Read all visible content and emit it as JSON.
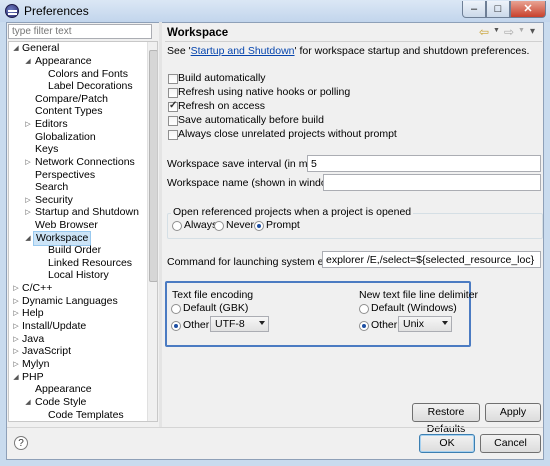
{
  "window": {
    "title": "Preferences"
  },
  "filter": {
    "placeholder": "type filter text"
  },
  "tree": [
    "General",
    "Appearance",
    "Colors and Fonts",
    "Label Decorations",
    "Compare/Patch",
    "Content Types",
    "Editors",
    "Globalization",
    "Keys",
    "Network Connections",
    "Perspectives",
    "Search",
    "Security",
    "Startup and Shutdown",
    "Web Browser",
    "Workspace",
    "Build Order",
    "Linked Resources",
    "Local History",
    "C/C++",
    "Dynamic Languages",
    "Help",
    "Install/Update",
    "Java",
    "JavaScript",
    "Mylyn",
    "PHP",
    "Appearance",
    "Code Style",
    "Code Templates"
  ],
  "page": {
    "title": "Workspace",
    "see_prefix": "See '",
    "see_link": "Startup and Shutdown",
    "see_suffix": "' for workspace startup and shutdown preferences.",
    "checkboxes": [
      {
        "label": "Build automatically",
        "checked": false
      },
      {
        "label": "Refresh using native hooks or polling",
        "checked": false
      },
      {
        "label": "Refresh on access",
        "checked": true
      },
      {
        "label": "Save automatically before build",
        "checked": false
      },
      {
        "label": "Always close unrelated projects without prompt",
        "checked": false
      }
    ],
    "save_interval_label": "Workspace save interval (in minutes):",
    "save_interval_value": "5",
    "workspace_name_label": "Workspace name (shown in window title):",
    "workspace_name_value": "",
    "open_projects_group": "Open referenced projects when a project is opened",
    "open_projects_options": [
      "Always",
      "Never",
      "Prompt"
    ],
    "open_projects_selected": "Prompt",
    "explorer_label": "Command for launching system explorer:",
    "explorer_value": "explorer /E,/select=${selected_resource_loc}",
    "encoding_group": "Text file encoding",
    "encoding_default": "Default (GBK)",
    "encoding_other": "Other:",
    "encoding_value": "UTF-8",
    "delimiter_group": "New text file line delimiter",
    "delimiter_default": "Default (Windows)",
    "delimiter_other": "Other:",
    "delimiter_value": "Unix",
    "restore_defaults": "Restore Defaults",
    "apply": "Apply"
  },
  "dialog": {
    "ok": "OK",
    "cancel": "Cancel",
    "help": "?"
  }
}
